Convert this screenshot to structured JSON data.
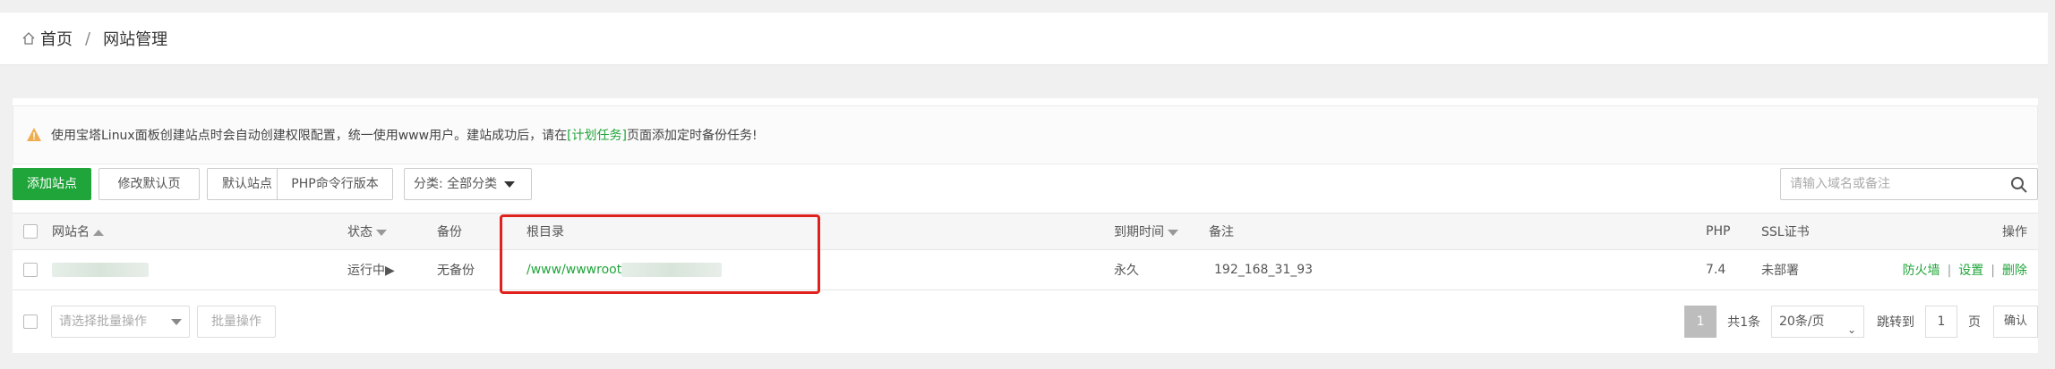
{
  "breadcrumb": {
    "home": "首页",
    "separator": "/",
    "current": "网站管理"
  },
  "notice": {
    "text_before": "使用宝塔Linux面板创建站点时会自动创建权限配置，统一使用www用户。建站成功后，请在",
    "link": "[计划任务]",
    "text_after": "页面添加定时备份任务!"
  },
  "toolbar": {
    "add_site": "添加站点",
    "modify_default_page": "修改默认页",
    "default_site": "默认站点",
    "php_cli_version": "PHP命令行版本",
    "category_select": "分类: 全部分类",
    "search_placeholder": "请输入域名或备注"
  },
  "table": {
    "headers": {
      "site_name": "网站名",
      "status": "状态",
      "backup": "备份",
      "root_dir": "根目录",
      "expire": "到期时间",
      "remark": "备注",
      "php": "PHP",
      "ssl": "SSL证书",
      "actions": "操作"
    },
    "rows": [
      {
        "status": "运行中▶",
        "backup": "无备份",
        "root_dir": "/www/wwwroot",
        "expire": "永久",
        "remark": "192_168_31_93",
        "php": "7.4",
        "ssl": "未部署",
        "action_firewall": "防火墙",
        "action_settings": "设置",
        "action_delete": "删除"
      }
    ]
  },
  "footer": {
    "batch_select_placeholder": "请选择批量操作",
    "batch_button": "批量操作",
    "current_page": "1",
    "total": "共1条",
    "page_size": "20条/页",
    "jump_label": "跳转到",
    "jump_value": "1",
    "page_unit": "页",
    "confirm": "确认"
  },
  "colors": {
    "accent": "#20a53a",
    "warning": "#f0ad4e",
    "highlight": "#e0221c"
  }
}
